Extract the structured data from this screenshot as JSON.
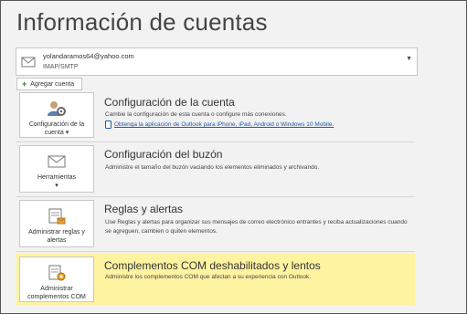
{
  "header": {
    "title": "Información de cuentas"
  },
  "account": {
    "email": "yolandaramos64@yahoo.com",
    "type": "IMAP/SMTP"
  },
  "add_account": {
    "label": "Agregar cuenta"
  },
  "sections": [
    {
      "tile_label": "Configuración de la cuenta ▾",
      "title": "Configuración de la cuenta",
      "description": "Cambie la configuración de esta cuenta o configure más conexiones.",
      "link": "Obtenga la aplicación de Outlook para iPhone, iPad, Android o Windows 10 Mobile."
    },
    {
      "tile_label": "Herramientas",
      "tile_caret": "▾",
      "title": "Configuración del buzón",
      "description": "Administre el tamaño del buzón vaciando los elementos eliminados y archivando."
    },
    {
      "tile_label": "Administrar reglas y alertas",
      "title": "Reglas y alertas",
      "description": "Use Reglas y alertas para organizar sus mensajes de correo electrónico entrantes y reciba actualizaciones cuando se agreguen, cambien o quiten elementos."
    },
    {
      "tile_label": "Administrar complementos COM",
      "title": "Complementos COM deshabilitados y lentos",
      "description": "Administre los complementos COM que afectan a su experiencia con Outlook."
    }
  ],
  "colors": {
    "highlight": "#fef3a0",
    "link": "#1f5aa6",
    "background": "#f2f2f2"
  }
}
